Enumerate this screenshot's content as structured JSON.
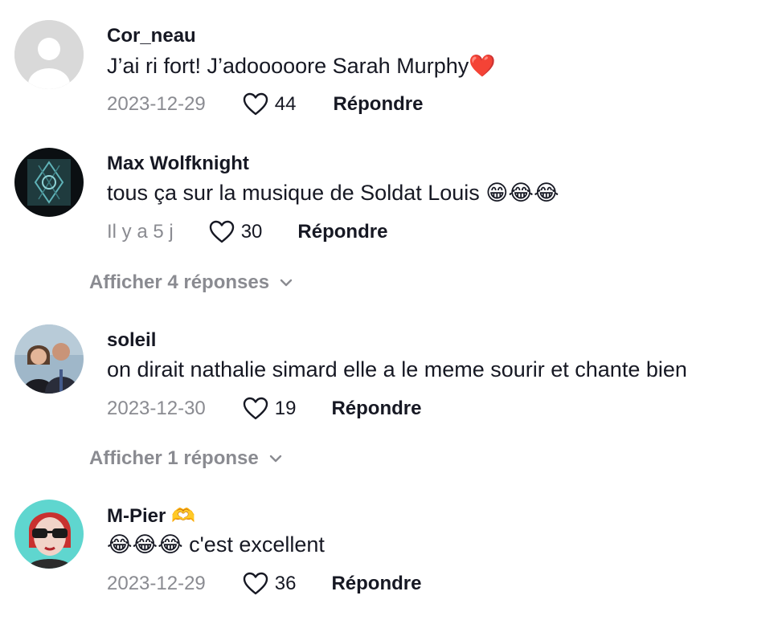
{
  "comments": [
    {
      "username": "Cor_neau",
      "text": "J’ai ri fort! J’adooooore Sarah Murphy❤️",
      "date": "2023-12-29",
      "likes": "44",
      "reply_label": "Répondre"
    },
    {
      "username": "Max Wolfknight",
      "text": "tous ça sur la musique de Soldat Louis 😁😂😂",
      "date": "Il y a 5 j",
      "likes": "30",
      "reply_label": "Répondre",
      "view_replies": "Afficher 4 réponses"
    },
    {
      "username": "soleil",
      "text": "on dirait nathalie simard elle a le meme sourir et chante bien",
      "date": "2023-12-30",
      "likes": "19",
      "reply_label": "Répondre",
      "view_replies": "Afficher 1 réponse"
    },
    {
      "username": "M-Pier 🫶",
      "text": "😂😂😂 c'est excellent",
      "date": "2023-12-29",
      "likes": "36",
      "reply_label": "Répondre"
    }
  ],
  "icons": {
    "like": "heart-outline-icon",
    "expand": "chevron-down-icon"
  },
  "colors": {
    "primary_text": "#161823",
    "secondary_text": "#8a8b91",
    "emoji_heart": "#e3262f"
  }
}
